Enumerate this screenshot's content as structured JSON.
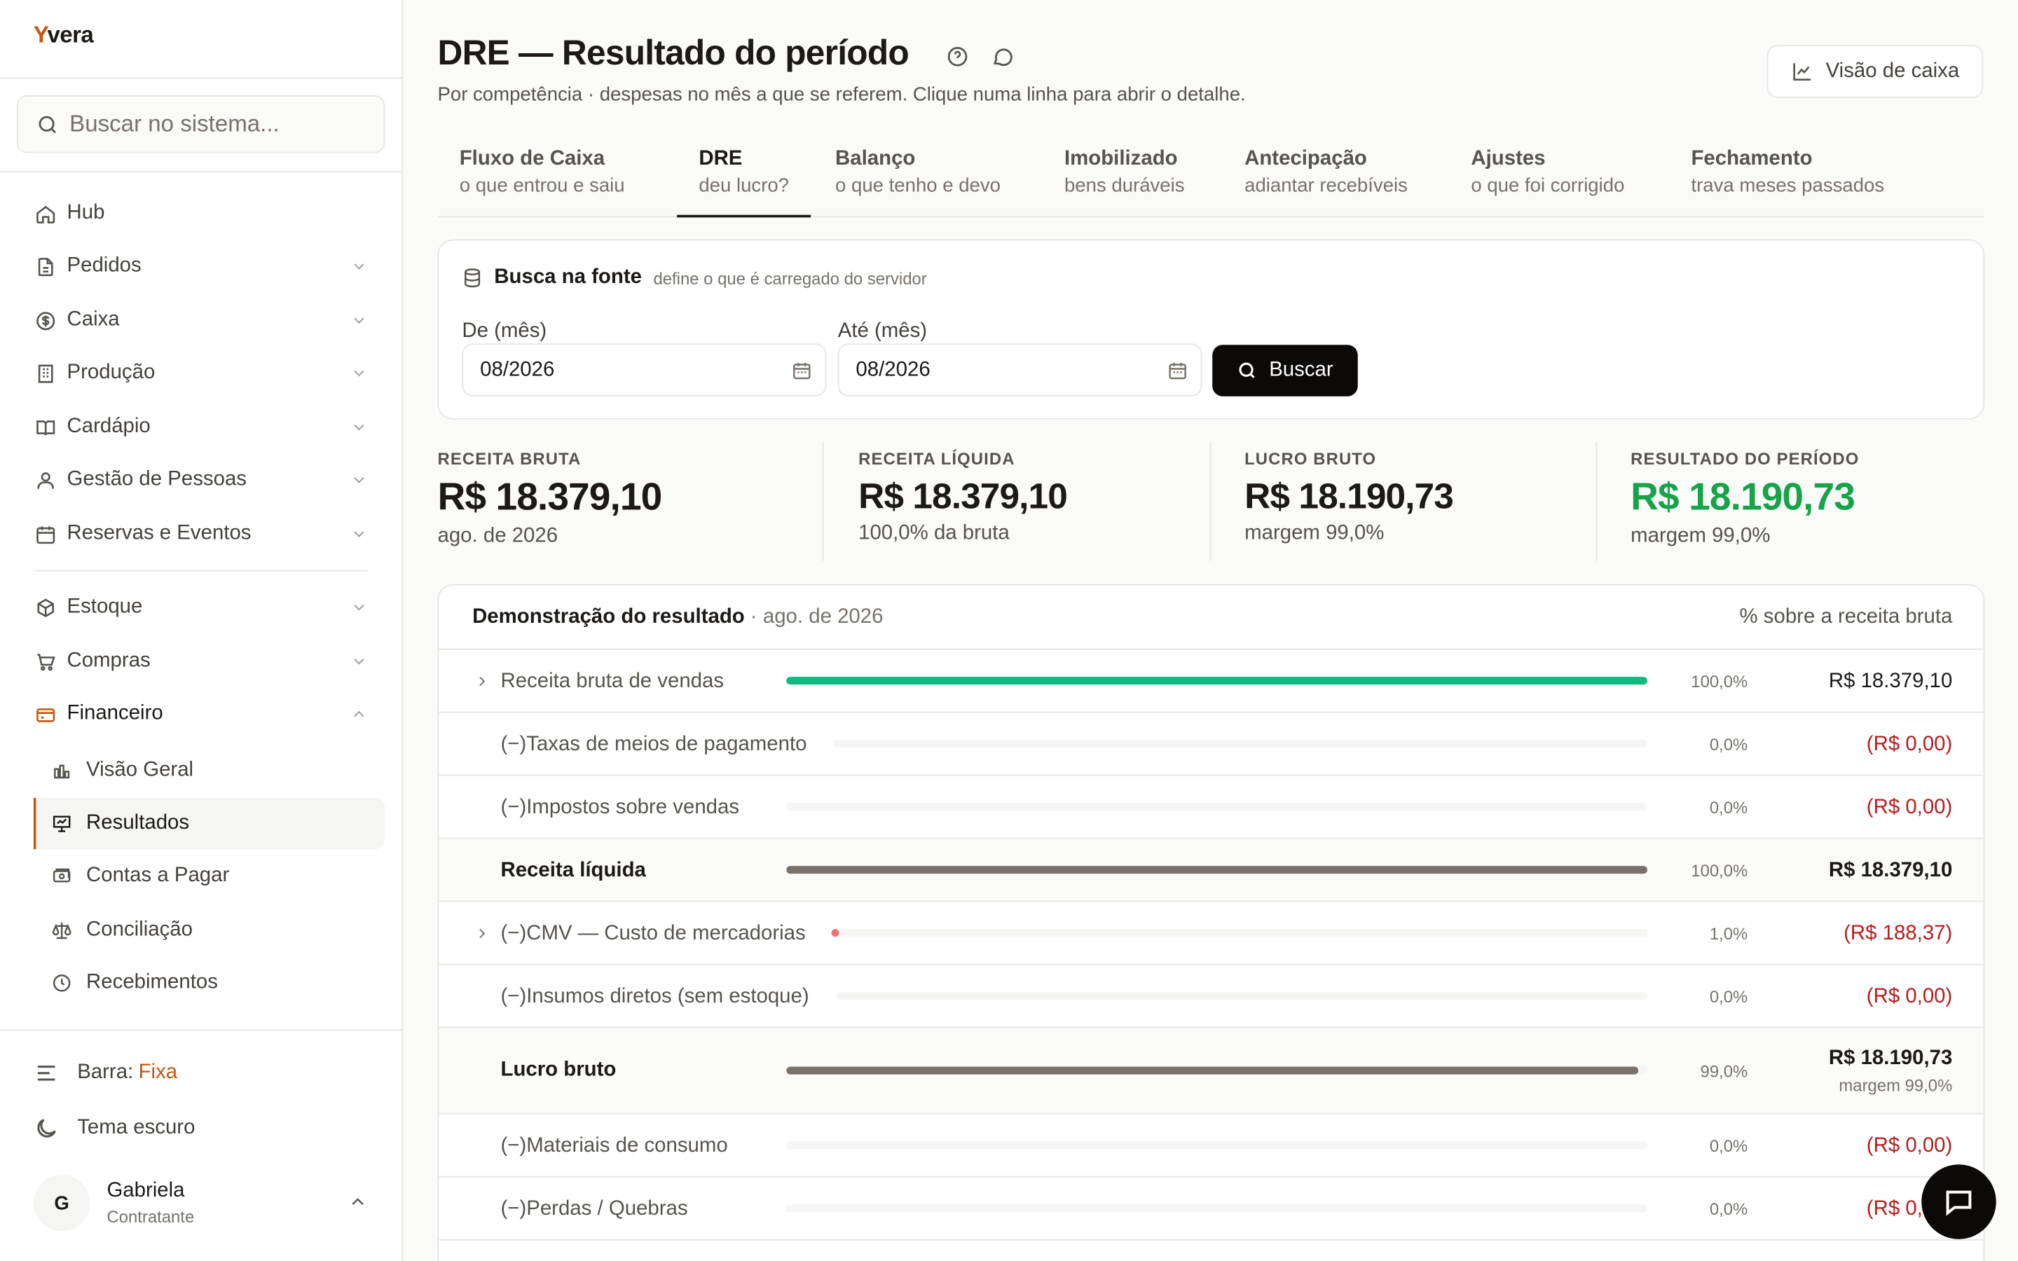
{
  "brand": {
    "first": "Y",
    "rest": "vera"
  },
  "search": {
    "placeholder": "Buscar no sistema..."
  },
  "nav": [
    {
      "label": "Hub",
      "icon": "home-icon"
    },
    {
      "label": "Pedidos",
      "icon": "file-icon"
    },
    {
      "label": "Caixa",
      "icon": "dollar-circle-icon"
    },
    {
      "label": "Produção",
      "icon": "building-icon"
    },
    {
      "label": "Cardápio",
      "icon": "book-icon"
    },
    {
      "label": "Gestão de Pessoas",
      "icon": "users-icon"
    },
    {
      "label": "Reservas e Eventos",
      "icon": "calendar-icon"
    },
    {
      "label": "Estoque",
      "icon": "box-icon"
    },
    {
      "label": "Compras",
      "icon": "cart-icon"
    },
    {
      "label": "Financeiro",
      "icon": "wallet-icon"
    }
  ],
  "financeiro_sub": [
    {
      "label": "Visão Geral",
      "icon": "bar-chart-icon"
    },
    {
      "label": "Resultados",
      "icon": "presentation-icon"
    },
    {
      "label": "Contas a Pagar",
      "icon": "bill-icon"
    },
    {
      "label": "Conciliação",
      "icon": "scale-icon"
    },
    {
      "label": "Recebimentos",
      "icon": "clock-icon"
    }
  ],
  "footer": {
    "bar_label": "Barra:",
    "bar_value": "Fixa",
    "theme_label": "Tema escuro",
    "user_initial": "G",
    "user_name": "Gabriela",
    "user_role": "Contratante"
  },
  "page": {
    "title": "DRE — Resultado do período",
    "subtitle": "Por competência · despesas no mês a que se referem. Clique numa linha para abrir o detalhe.",
    "cash_button": "Visão de caixa"
  },
  "tabs": [
    {
      "label": "Fluxo de Caixa",
      "sub": "o que entrou e saiu"
    },
    {
      "label": "DRE",
      "sub": "deu lucro?"
    },
    {
      "label": "Balanço",
      "sub": "o que tenho e devo"
    },
    {
      "label": "Imobilizado",
      "sub": "bens duráveis"
    },
    {
      "label": "Antecipação",
      "sub": "adiantar recebíveis"
    },
    {
      "label": "Ajustes",
      "sub": "o que foi corrigido"
    },
    {
      "label": "Fechamento",
      "sub": "trava meses passados"
    }
  ],
  "fonte": {
    "title": "Busca na fonte",
    "hint": "define o que é carregado do servidor",
    "from_label": "De (mês)",
    "from_value": "08/2026",
    "to_label": "Até (mês)",
    "to_value": "08/2026",
    "button": "Buscar"
  },
  "kpis": [
    {
      "label": "RECEITA BRUTA",
      "value": "R$ 18.379,10",
      "sub": "ago. de 2026"
    },
    {
      "label": "RECEITA LÍQUIDA",
      "value": "R$ 18.379,10",
      "sub": "100,0% da bruta"
    },
    {
      "label": "LUCRO BRUTO",
      "value": "R$ 18.190,73",
      "sub": "margem 99,0%"
    },
    {
      "label": "RESULTADO DO PERÍODO",
      "value": "R$ 18.190,73",
      "sub": "margem 99,0%"
    }
  ],
  "dre": {
    "title": "Demonstração do resultado",
    "period": " · ago. de 2026",
    "right_label": "% sobre a receita bruta",
    "rows": [
      {
        "label": "Receita bruta de vendas",
        "pct": "100,0%",
        "pct_value": 100.0,
        "amount": "R$ 18.379,10",
        "kind": "revenue",
        "expandable": true
      },
      {
        "label": "(−)Taxas de meios de pagamento",
        "pct": "0,0%",
        "pct_value": 0.0,
        "amount": "(R$ 0,00)",
        "kind": "expense",
        "expandable": false
      },
      {
        "label": "(−)Impostos sobre vendas",
        "pct": "0,0%",
        "pct_value": 0.0,
        "amount": "(R$ 0,00)",
        "kind": "expense",
        "expandable": false
      },
      {
        "label": "Receita líquida",
        "pct": "100,0%",
        "pct_value": 100.0,
        "amount": "R$ 18.379,10",
        "kind": "subtotal",
        "expandable": false
      },
      {
        "label": "(−)CMV — Custo de mercadorias",
        "pct": "1,0%",
        "pct_value": 1.0,
        "amount": "(R$ 188,37)",
        "kind": "expense",
        "expandable": true
      },
      {
        "label": "(−)Insumos diretos (sem estoque)",
        "pct": "0,0%",
        "pct_value": 0.0,
        "amount": "(R$ 0,00)",
        "kind": "expense",
        "expandable": false
      },
      {
        "label": "Lucro bruto",
        "pct": "99,0%",
        "pct_value": 99.0,
        "amount": "R$ 18.190,73",
        "amount_sub": "margem 99,0%",
        "kind": "subtotal",
        "expandable": false
      },
      {
        "label": "(−)Materiais de consumo",
        "pct": "0,0%",
        "pct_value": 0.0,
        "amount": "(R$ 0,00)",
        "kind": "expense",
        "expandable": false
      },
      {
        "label": "(−)Perdas / Quebras",
        "pct": "0,0%",
        "pct_value": 0.0,
        "amount": "(R$ 0,00)",
        "kind": "expense",
        "expandable": false
      }
    ]
  },
  "colors": {
    "accent": "#c2570c",
    "positive": "#16a34a",
    "negative": "#b91c1c",
    "revenue_bar": "#10b981",
    "subtotal_bar": "#78716c",
    "expense_dot": "#f87171"
  }
}
